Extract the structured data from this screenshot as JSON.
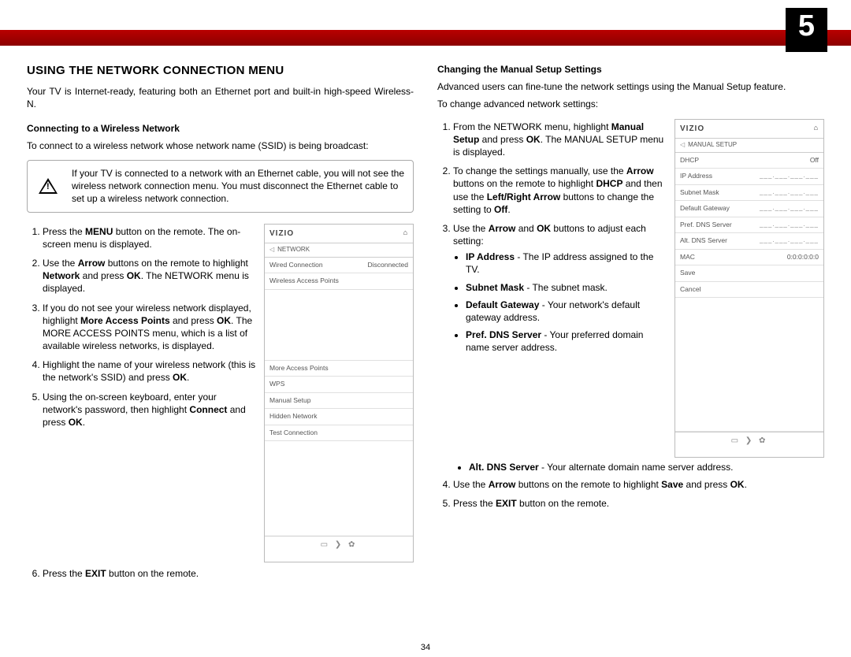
{
  "page_number": "5",
  "footer_page": "34",
  "heading": "USING THE NETWORK CONNECTION MENU",
  "intro": "Your TV is Internet-ready, featuring both an Ethernet port and built-in high-speed Wireless-N.",
  "sub1": "Connecting to a Wireless Network",
  "sub1_intro": "To connect to a wireless network whose network name (SSID) is being broadcast:",
  "warning": "If your TV is connected to a network with an Ethernet cable, you will not see the wireless network connection menu. You must disconnect the Ethernet cable to set up a wireless network connection.",
  "steps1": {
    "s1a": "Press the ",
    "s1b": "MENU",
    "s1c": " button on the remote. The on-screen menu is displayed.",
    "s2a": "Use the ",
    "s2b": "Arrow",
    "s2c": " buttons on the remote to highlight ",
    "s2d": "Network",
    "s2e": " and press ",
    "s2f": "OK",
    "s2g": ". The NETWORK menu is displayed.",
    "s3a": "If you do not see your wireless network displayed, highlight ",
    "s3b": "More Access Points",
    "s3c": " and press ",
    "s3d": "OK",
    "s3e": ". The MORE ACCESS POINTS menu, which is a list of available wireless networks, is displayed.",
    "s4a": "Highlight the name of your wireless network (this is the network's SSID) and press ",
    "s4b": "OK",
    "s4c": ".",
    "s5a": "Using the on-screen keyboard, enter your network's password, then highlight ",
    "s5b": "Connect",
    "s5c": " and press ",
    "s5d": "OK",
    "s5e": ".",
    "s6a": "Press the ",
    "s6b": "EXIT",
    "s6c": " button on the remote."
  },
  "sub2": "Changing the Manual Setup Settings",
  "sub2_intro": "Advanced users can fine-tune the network settings using the Manual Setup feature.",
  "sub2_lead": "To change advanced network settings:",
  "steps2": {
    "s1a": "From the NETWORK menu, highlight ",
    "s1b": "Manual Setup",
    "s1c": " and press ",
    "s1d": "OK",
    "s1e": ". The MANUAL SETUP menu is displayed.",
    "s2a": "To change the settings manually, use the ",
    "s2b": "Arrow",
    "s2c": " buttons on the remote to highlight ",
    "s2d": "DHCP",
    "s2e": " and then use the ",
    "s2f": "Left/Right Arrow",
    "s2g": " buttons to change the setting to ",
    "s2h": "Off",
    "s2i": ".",
    "s3a": "Use the ",
    "s3b": "Arrow",
    "s3c": " and ",
    "s3d": "OK",
    "s3e": " buttons to adjust each setting:",
    "b1a": "IP Address",
    "b1b": " - The IP address assigned to the TV.",
    "b2a": "Subnet Mask",
    "b2b": " - The subnet mask.",
    "b3a": "Default Gateway",
    "b3b": " - Your network's default gateway address.",
    "b4a": "Pref. DNS Server",
    "b4b": " - Your preferred domain name server address.",
    "b5a": "Alt. DNS Server",
    "b5b": " - Your alternate domain name server address.",
    "s4a": "Use the ",
    "s4b": "Arrow",
    "s4c": " buttons on the remote to highlight ",
    "s4d": "Save",
    "s4e": " and press ",
    "s4f": "OK",
    "s4g": ".",
    "s5a": "Press the ",
    "s5b": "EXIT",
    "s5c": " button on the remote."
  },
  "menu1": {
    "brand": "VIZIO",
    "crumb": "NETWORK",
    "row1_l": "Wired Connection",
    "row1_r": "Disconnected",
    "row2": "Wireless Access Points",
    "row3": "More Access Points",
    "row4": "WPS",
    "row5": "Manual Setup",
    "row6": "Hidden Network",
    "row7": "Test Connection"
  },
  "menu2": {
    "brand": "VIZIO",
    "crumb": "MANUAL SETUP",
    "dhcp_l": "DHCP",
    "dhcp_r": "Off",
    "ip": "IP Address",
    "sm": "Subnet Mask",
    "dg": "Default Gateway",
    "pdns": "Pref. DNS Server",
    "adns": "Alt. DNS Server",
    "blank": "___.___.___.___",
    "mac_l": "MAC",
    "mac_r": "0:0:0:0:0:0",
    "save": "Save",
    "cancel": "Cancel"
  },
  "foot_icons": "▭  ❯  ✿"
}
